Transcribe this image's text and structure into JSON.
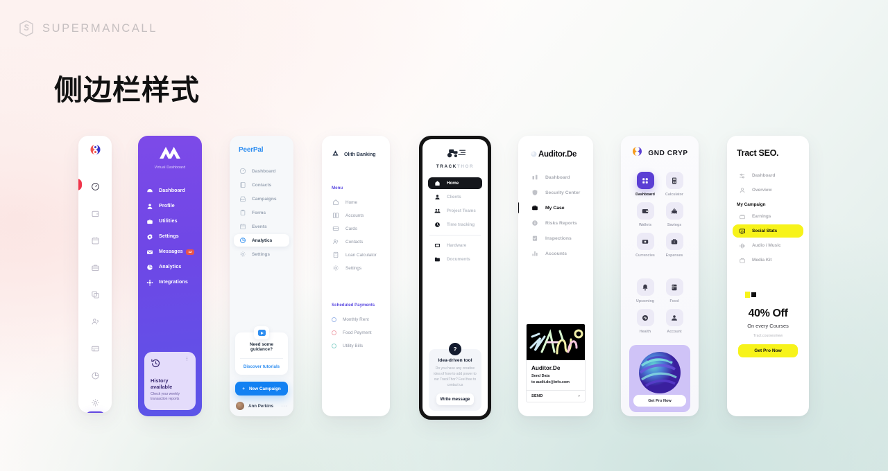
{
  "header": {
    "brand_name": "SUPERMANCALL",
    "brand_icon": "s-monogram-icon",
    "page_title": "侧边栏样式"
  },
  "cards": {
    "icon_rail": {
      "logo_icon": "yin-yang-logo-icon",
      "items": [
        {
          "icon": "gauge-icon",
          "active": true
        },
        {
          "icon": "wallet-icon",
          "active": false
        },
        {
          "icon": "calendar-icon",
          "active": false
        },
        {
          "icon": "briefcase-icon",
          "active": false
        },
        {
          "icon": "copy-icon",
          "active": false
        },
        {
          "icon": "users-icon",
          "active": false
        },
        {
          "icon": "card-icon",
          "active": false
        },
        {
          "icon": "pie-chart-icon",
          "active": false
        },
        {
          "icon": "gear-icon",
          "active": false
        }
      ],
      "add_label": "+"
    },
    "virtual_dashboard": {
      "logo_icon": "mountain-logo-icon",
      "subtitle": "Virtual Dashboard",
      "items": [
        {
          "label": "Dashboard",
          "icon": "dashboard-icon",
          "badge": ""
        },
        {
          "label": "Profile",
          "icon": "user-icon",
          "badge": ""
        },
        {
          "label": "Utilities",
          "icon": "toolbox-icon",
          "badge": ""
        },
        {
          "label": "Settings",
          "icon": "gear-icon",
          "badge": ""
        },
        {
          "label": "Messages",
          "icon": "mail-icon",
          "badge": "12"
        },
        {
          "label": "Analytics",
          "icon": "pie-chart-icon",
          "badge": ""
        },
        {
          "label": "Integrations",
          "icon": "puzzle-icon",
          "badge": ""
        }
      ],
      "promo": {
        "icon": "history-clock-icon",
        "menu_icon": "vertical-dots-icon",
        "title": "History available",
        "text": "Check your weekly transaction reports"
      }
    },
    "peerpal": {
      "logo": "PeerPal",
      "items": [
        {
          "label": "Dashboard",
          "icon": "gauge-icon",
          "active": false
        },
        {
          "label": "Contacts",
          "icon": "book-icon",
          "active": false
        },
        {
          "label": "Campaigns",
          "icon": "inbox-icon",
          "active": false
        },
        {
          "label": "Forms",
          "icon": "clipboard-icon",
          "active": false
        },
        {
          "label": "Events",
          "icon": "calendar-icon",
          "active": false
        },
        {
          "label": "Analytics",
          "icon": "pie-chart-icon",
          "active": true
        },
        {
          "label": "Settings",
          "icon": "gear-icon",
          "active": false
        }
      ],
      "promo": {
        "play_icon": "play-video-icon",
        "question": "Need some guidance?",
        "link": "Discover tutorials"
      },
      "cta": {
        "label": "New Campaign",
        "icon": "plus-icon"
      },
      "user": {
        "name": "Ann Perkins",
        "avatar": "avatar-icon",
        "more_icon": "ellipsis-icon"
      }
    },
    "olith_banking": {
      "logo_icon": "triangle-drop-icon",
      "name": "Olith Banking",
      "menu_title": "Menu",
      "menu_items": [
        {
          "label": "Home",
          "icon": "home-icon"
        },
        {
          "label": "Accounts",
          "icon": "grid-icon"
        },
        {
          "label": "Cards",
          "icon": "card-icon"
        },
        {
          "label": "Contacts",
          "icon": "users-icon"
        },
        {
          "label": "Loan Calculator",
          "icon": "calculator-icon"
        },
        {
          "label": "Settings",
          "icon": "gear-icon"
        }
      ],
      "payments_title": "Scheduled Payments",
      "payments": [
        {
          "label": "Monthly Rent",
          "color": "#9fb8e8"
        },
        {
          "label": "Food Payment",
          "color": "#f0a6ae"
        },
        {
          "label": "Utility Bills",
          "color": "#8fd3cc"
        }
      ]
    },
    "trackthor": {
      "logo_icon": "tractor-icon",
      "word_primary": "TRACK",
      "word_secondary": "THOR",
      "items": [
        {
          "label": "Home",
          "icon": "home-icon",
          "active": true
        },
        {
          "label": "Clients",
          "icon": "user-icon",
          "active": false
        },
        {
          "label": "Project Teams",
          "icon": "team-icon",
          "active": false
        },
        {
          "label": "Time tracking",
          "icon": "clock-icon",
          "active": false
        }
      ],
      "items2": [
        {
          "label": "Hardware",
          "icon": "monitor-icon",
          "active": false
        },
        {
          "label": "Documents",
          "icon": "folder-icon",
          "active": false
        }
      ],
      "promo": {
        "badge_icon": "question-mark-icon",
        "title": "Idea-driven tool",
        "text": "Do you have any creative idea of how to add power to our TrackThor? Feel free to contact us",
        "button": "Write message"
      }
    },
    "auditor": {
      "logo_icon": "sphere-logo-icon",
      "name": "Auditor.De",
      "items": [
        {
          "label": "Dashboard",
          "icon": "bar-chart-icon",
          "active": false
        },
        {
          "label": "Security Center",
          "icon": "shield-icon",
          "active": false
        },
        {
          "label": "My Case",
          "icon": "briefcase-icon",
          "active": true
        },
        {
          "label": "Risks Reports",
          "icon": "info-icon",
          "active": false
        },
        {
          "label": "Inspections",
          "icon": "clipboard-check-icon",
          "active": false
        },
        {
          "label": "Accounts",
          "icon": "stats-icon",
          "active": false
        }
      ],
      "card": {
        "art": "abstract-scribble-art",
        "title": "Auditor.De",
        "line1": "Send Data",
        "line2": "to audit.de@info.com",
        "send_label": "SEND",
        "send_icon": "chevron-right-icon"
      }
    },
    "gnd_cryp": {
      "logo_icon": "orange-purple-swirl-icon",
      "name": "GND CRYP",
      "tiles": [
        {
          "label": "Dashboard",
          "icon": "grid-dots-icon",
          "active": true
        },
        {
          "label": "Calculator",
          "icon": "calculator-icon",
          "active": false
        },
        {
          "label": "Wallets",
          "icon": "wallet-icon",
          "active": false
        },
        {
          "label": "Savings",
          "icon": "piggy-bank-icon",
          "active": false
        },
        {
          "label": "Currencies",
          "icon": "coin-icon",
          "active": false
        },
        {
          "label": "Expenses",
          "icon": "briefcase-icon",
          "active": false
        }
      ],
      "tiles2": [
        {
          "label": "Upcoming",
          "icon": "bell-icon",
          "active": false
        },
        {
          "label": "Food",
          "icon": "fridge-icon",
          "active": false
        },
        {
          "label": "Health",
          "icon": "heart-pulse-icon",
          "active": false
        },
        {
          "label": "Account",
          "icon": "person-icon",
          "active": false
        }
      ],
      "promo": {
        "art": "3d-sphere-art",
        "button": "Get Pro Now"
      }
    },
    "tract_seo": {
      "title": "Tract SEO.",
      "items": [
        {
          "label": "Dashboard",
          "icon": "sliders-icon",
          "active": false
        },
        {
          "label": "Overview",
          "icon": "person-icon",
          "active": false
        }
      ],
      "section_title": "My Campaign",
      "items2": [
        {
          "label": "Earnings",
          "icon": "wallet-icon",
          "active": false
        },
        {
          "label": "Social Stats",
          "icon": "chat-stats-icon",
          "active": true
        },
        {
          "label": "Audio / Music",
          "icon": "waveform-icon",
          "active": false
        },
        {
          "label": "Media Kit",
          "icon": "bag-icon",
          "active": false
        }
      ],
      "promo": {
        "mark": "yellow-black-squares-icon",
        "headline": "40% Off",
        "subline": "On every Courses",
        "url": "Tract.courses/new",
        "button": "Get Pro Now"
      }
    }
  },
  "colors": {
    "purple": "#6246e0",
    "blue": "#1381f2",
    "yellow": "#f7f31a",
    "red_badge": "#e8544a",
    "dark": "#141414"
  }
}
